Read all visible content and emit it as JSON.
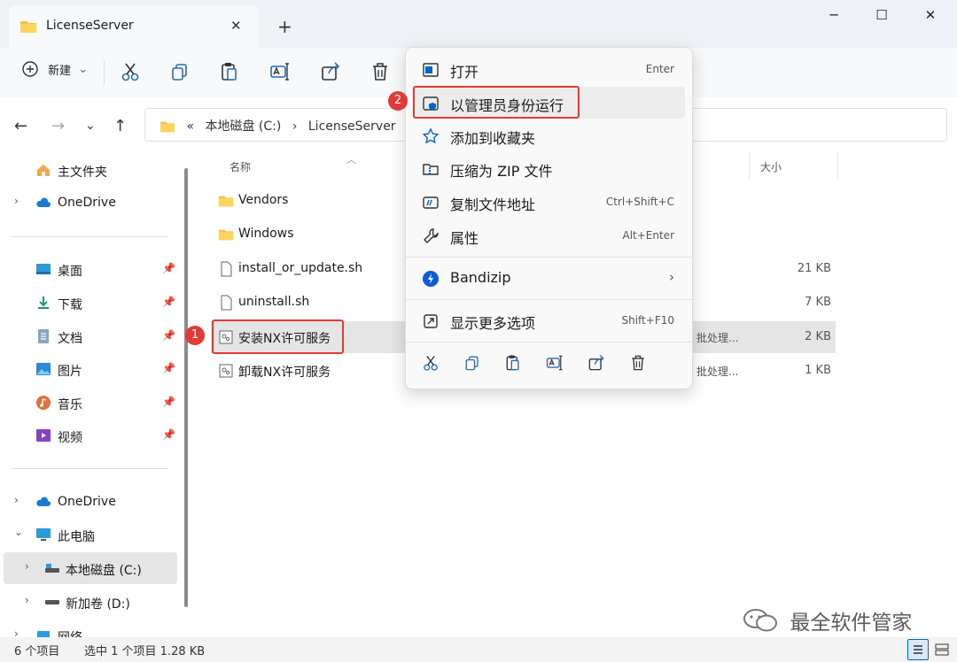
{
  "window": {
    "tab_title": "LicenseServer",
    "tab_close": "✕",
    "new_tab": "+",
    "minimize": "─",
    "maximize": "☐",
    "close": "✕"
  },
  "toolbar": {
    "new_label": "新建",
    "new_chevron": "⌄"
  },
  "address": {
    "overflow": "«",
    "crumb1": "本地磁盘 (C:)",
    "crumb_sep": "›",
    "crumb2": "LicenseServer"
  },
  "sidebar": {
    "home": "主文件夹",
    "onedrive_top": "OneDrive",
    "desktop": "桌面",
    "downloads": "下载",
    "documents": "文档",
    "pictures": "图片",
    "music": "音乐",
    "videos": "视频",
    "onedrive": "OneDrive",
    "this_pc": "此电脑",
    "local_disk": "本地磁盘 (C:)",
    "new_volume": "新加卷 (D:)",
    "network": "网络"
  },
  "filelist": {
    "col_name": "名称",
    "col_size": "大小",
    "rows": [
      {
        "name": "Vendors",
        "type": "",
        "size": ""
      },
      {
        "name": "Windows",
        "type": "",
        "size": ""
      },
      {
        "name": "install_or_update.sh",
        "type": "",
        "size": "21 KB"
      },
      {
        "name": "uninstall.sh",
        "type": "",
        "size": "7 KB"
      },
      {
        "name": "安装NX许可服务",
        "type": "批处理...",
        "size": "2 KB"
      },
      {
        "name": "卸载NX许可服务",
        "type": "批处理...",
        "size": "1 KB"
      }
    ]
  },
  "context_menu": {
    "open": "打开",
    "open_sc": "Enter",
    "run_as_admin": "以管理员身份运行",
    "add_favorites": "添加到收藏夹",
    "compress_zip": "压缩为 ZIP 文件",
    "copy_path": "复制文件地址",
    "copy_path_sc": "Ctrl+Shift+C",
    "properties": "属性",
    "properties_sc": "Alt+Enter",
    "bandizip": "Bandizip",
    "more_options": "显示更多选项",
    "more_options_sc": "Shift+F10"
  },
  "annotations": {
    "badge1": "1",
    "badge2": "2"
  },
  "status": {
    "count": "6 个项目",
    "selected": "选中 1 个项目  1.28 KB"
  },
  "watermark": "最全软件管家",
  "colors": {
    "accent": "#0067c0",
    "highlight_red": "#e53935",
    "selected_row": "#e5e5e5"
  }
}
